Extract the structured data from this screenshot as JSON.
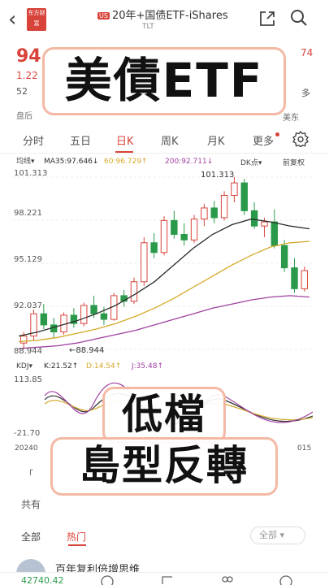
{
  "header": {
    "brand_label": "东方财富",
    "market_tag": "US",
    "title": "20年+国债ETF-iShares",
    "ticker": "TLT"
  },
  "quote": {
    "price": "94",
    "change": "1.22",
    "right_top": "74",
    "week52_label": "52",
    "right_52": "多",
    "after_hours": "盘后",
    "market": "美东"
  },
  "tabs": {
    "items": [
      "分时",
      "五日",
      "日K",
      "周K",
      "月K",
      "更多"
    ],
    "active": "日K"
  },
  "indicators": {
    "ma_type": "均线▾",
    "ma35": "MA35:97.646↓",
    "ma60": "60:96.729↑",
    "ma200": "200:92.711↓",
    "dk_label": "DK点▾",
    "adjust_label": "前复权"
  },
  "price_axis": {
    "labels": [
      "101.313",
      "98.221",
      "95.129",
      "92.037",
      "88.944"
    ],
    "high_label": "101.313",
    "low_label": "88.944"
  },
  "kdj": {
    "name": "KDJ▾",
    "k": "K:21.52↑",
    "d": "D:14.54↑",
    "j": "J:35.48↑",
    "axis_top": "113.85",
    "axis_bottom": "-21.70"
  },
  "dates": {
    "left": "20240",
    "right": "015"
  },
  "overlay": {
    "line1": "美債ETF",
    "line2": "低檔",
    "line3": "島型反轉"
  },
  "community": {
    "bracket": "「",
    "total_label": "共有",
    "segments": [
      "全部",
      "热门"
    ],
    "active_segment": "热门",
    "filter_label": "全部",
    "post_title": "百年复利倍增思维"
  },
  "bottom_bar": {
    "index_value": "42740.42"
  },
  "colors": {
    "up": "#d8433a",
    "down": "#2a9a4a",
    "ma35": "#2b2b2b",
    "ma60": "#d4a92a",
    "ma200": "#a040a0"
  },
  "chart_data": {
    "type": "candlestick",
    "title": "",
    "y_ticks": [
      101.313,
      98.221,
      95.129,
      92.037,
      88.944
    ],
    "ylim": [
      88.944,
      101.313
    ],
    "series": [
      {
        "name": "MA35",
        "values": [
          89.9,
          90.2,
          90.6,
          91.0,
          91.5,
          92.1,
          92.9,
          93.8,
          95.0,
          96.2,
          97.2,
          97.9,
          98.3,
          98.1,
          97.8,
          97.6
        ]
      },
      {
        "name": "MA60",
        "values": [
          89.5,
          89.6,
          89.8,
          90.1,
          90.4,
          90.8,
          91.3,
          91.9,
          92.6,
          93.4,
          94.2,
          95.0,
          95.7,
          96.3,
          96.6,
          96.7
        ]
      },
      {
        "name": "MA200",
        "values": [
          89.0,
          89.1,
          89.2,
          89.4,
          89.7,
          90.0,
          90.3,
          90.7,
          91.1,
          91.5,
          91.9,
          92.2,
          92.5,
          92.7,
          92.8,
          92.7
        ]
      }
    ],
    "candles": [
      {
        "o": 89.4,
        "h": 90.2,
        "l": 88.944,
        "c": 89.9
      },
      {
        "o": 89.9,
        "h": 91.8,
        "l": 89.6,
        "c": 91.5
      },
      {
        "o": 91.5,
        "h": 92.2,
        "l": 90.4,
        "c": 90.7
      },
      {
        "o": 90.7,
        "h": 91.2,
        "l": 89.8,
        "c": 90.2
      },
      {
        "o": 90.2,
        "h": 91.6,
        "l": 90.0,
        "c": 91.4
      },
      {
        "o": 91.4,
        "h": 91.9,
        "l": 90.5,
        "c": 90.8
      },
      {
        "o": 90.8,
        "h": 92.3,
        "l": 90.6,
        "c": 92.1
      },
      {
        "o": 92.1,
        "h": 92.8,
        "l": 91.2,
        "c": 91.5
      },
      {
        "o": 91.5,
        "h": 92.0,
        "l": 90.7,
        "c": 91.1
      },
      {
        "o": 91.1,
        "h": 93.0,
        "l": 91.0,
        "c": 92.8
      },
      {
        "o": 92.8,
        "h": 93.2,
        "l": 92.0,
        "c": 92.4
      },
      {
        "o": 92.4,
        "h": 94.1,
        "l": 92.2,
        "c": 93.8
      },
      {
        "o": 93.8,
        "h": 97.0,
        "l": 93.5,
        "c": 96.6
      },
      {
        "o": 96.6,
        "h": 97.3,
        "l": 95.5,
        "c": 95.9
      },
      {
        "o": 95.9,
        "h": 98.5,
        "l": 95.7,
        "c": 98.2
      },
      {
        "o": 98.2,
        "h": 98.9,
        "l": 96.9,
        "c": 97.2
      },
      {
        "o": 97.2,
        "h": 98.0,
        "l": 96.4,
        "c": 96.8
      },
      {
        "o": 96.8,
        "h": 98.6,
        "l": 96.6,
        "c": 98.3
      },
      {
        "o": 98.3,
        "h": 99.4,
        "l": 97.8,
        "c": 99.1
      },
      {
        "o": 99.1,
        "h": 99.6,
        "l": 98.0,
        "c": 98.4
      },
      {
        "o": 98.4,
        "h": 100.3,
        "l": 98.2,
        "c": 100.0
      },
      {
        "o": 100.0,
        "h": 101.313,
        "l": 99.5,
        "c": 100.9
      },
      {
        "o": 100.9,
        "h": 101.2,
        "l": 98.6,
        "c": 98.9
      },
      {
        "o": 98.9,
        "h": 99.5,
        "l": 97.6,
        "c": 97.8
      },
      {
        "o": 97.8,
        "h": 98.4,
        "l": 97.0,
        "c": 98.1
      },
      {
        "o": 98.1,
        "h": 99.0,
        "l": 96.2,
        "c": 96.4
      },
      {
        "o": 96.4,
        "h": 96.8,
        "l": 94.5,
        "c": 94.8
      },
      {
        "o": 94.8,
        "h": 95.5,
        "l": 93.0,
        "c": 93.3
      },
      {
        "o": 93.3,
        "h": 94.9,
        "l": 93.1,
        "c": 94.6
      }
    ]
  }
}
